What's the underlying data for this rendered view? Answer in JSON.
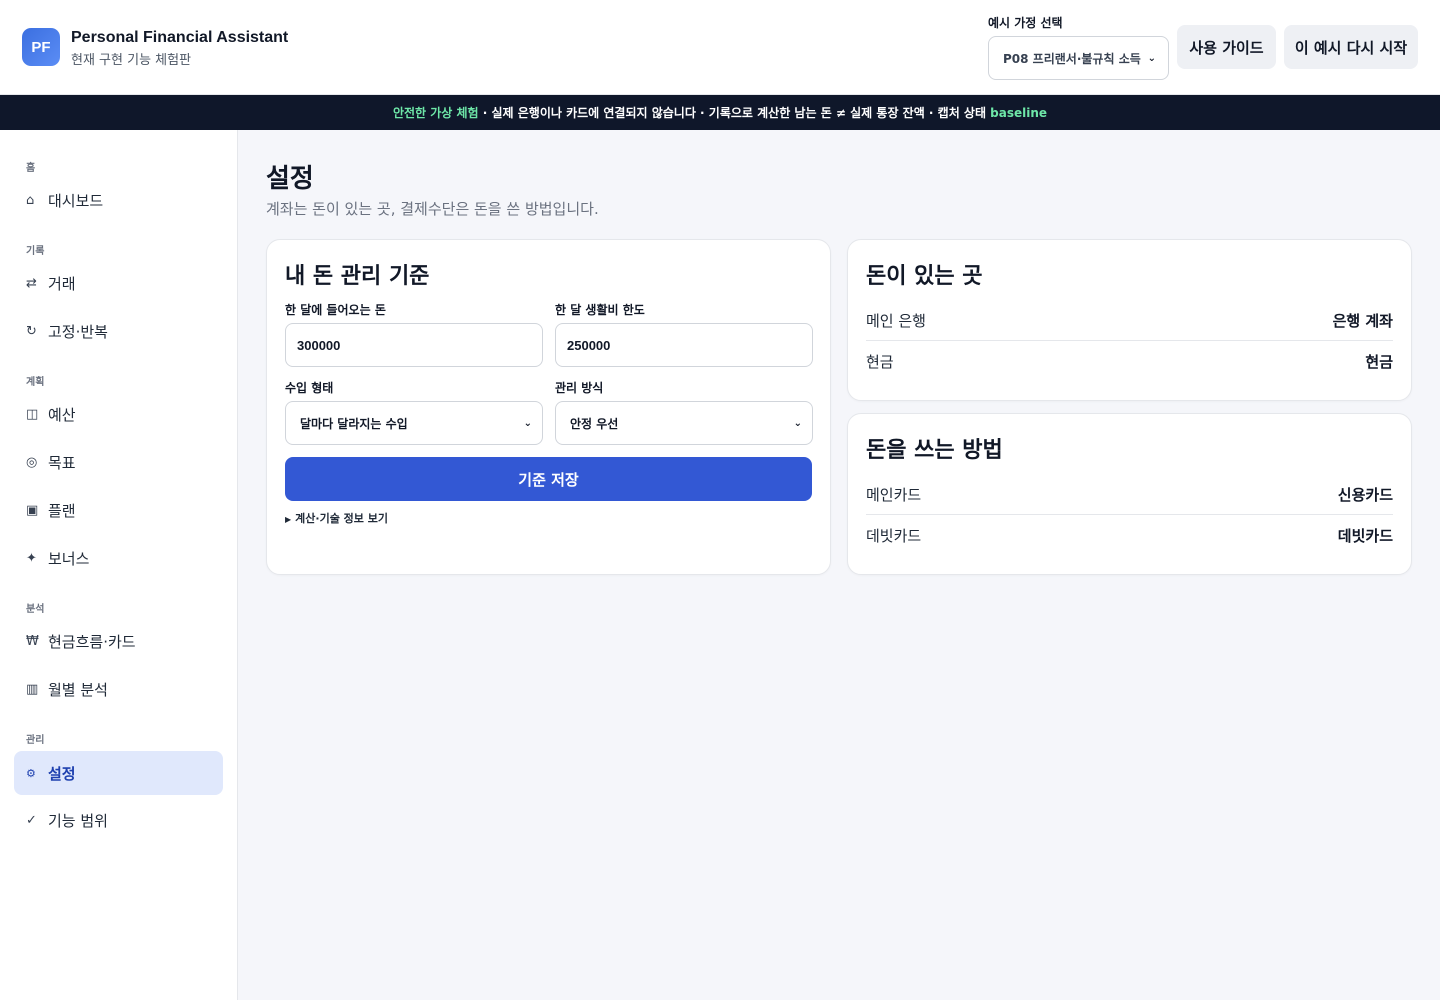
{
  "header": {
    "logo_text": "PF",
    "title": "Personal Financial Assistant",
    "subtitle": "현재 구현 기능 체험판",
    "persona_label": "예시 가정 선택",
    "persona_selected": "P08 프리랜서·불규칙 소득",
    "guide_button": "사용 가이드",
    "restart_button": "이 예시 다시 시작"
  },
  "banner": {
    "highlight": "안전한 가상 체험",
    "text": " · 실제 은행이나 카드에 연결되지 않습니다 · 기록으로 계산한 남는 돈 ≠ 실제 통장 잔액 · 캡처 상태 ",
    "state": "baseline"
  },
  "sidebar": {
    "sections": {
      "home": "홈",
      "records": "기록",
      "plan": "계획",
      "analysis": "분석",
      "manage": "관리"
    },
    "items": [
      {
        "label": "대시보드",
        "icon": "home-icon",
        "glyph": "⌂"
      },
      {
        "label": "거래",
        "icon": "transfer-icon",
        "glyph": "⇄"
      },
      {
        "label": "고정·반복",
        "icon": "repeat-icon",
        "glyph": "↻"
      },
      {
        "label": "예산",
        "icon": "budget-icon",
        "glyph": "◫"
      },
      {
        "label": "목표",
        "icon": "target-icon",
        "glyph": "◎"
      },
      {
        "label": "플랜",
        "icon": "plan-icon",
        "glyph": "▣"
      },
      {
        "label": "보너스",
        "icon": "sparkle-icon",
        "glyph": "✦"
      },
      {
        "label": "현금흐름·카드",
        "icon": "won-icon",
        "glyph": "₩"
      },
      {
        "label": "월별 분석",
        "icon": "bars-icon",
        "glyph": "▥"
      },
      {
        "label": "설정",
        "icon": "gear-icon",
        "glyph": "⚙"
      },
      {
        "label": "기능 범위",
        "icon": "check-icon",
        "glyph": "✓"
      }
    ]
  },
  "main": {
    "title": "설정",
    "subtitle": "계좌는 돈이 있는 곳, 결제수단은 돈을 쓴 방법입니다."
  },
  "standards_card": {
    "title": "내 돈 관리 기준",
    "monthly_income_label": "한 달에 들어오는 돈",
    "monthly_income_value": "300000",
    "living_limit_label": "한 달 생활비 한도",
    "living_limit_value": "250000",
    "income_type_label": "수입 형태",
    "income_type_value": "달마다 달라지는 수입",
    "mode_label": "관리 방식",
    "mode_value": "안정 우선",
    "save_button": "기준 저장",
    "details_toggle": "계산·기술 정보 보기"
  },
  "accounts_card": {
    "title": "돈이 있는 곳",
    "rows": [
      {
        "name": "메인 은행",
        "type": "은행 계좌"
      },
      {
        "name": "현금",
        "type": "현금"
      }
    ]
  },
  "payments_card": {
    "title": "돈을 쓰는 방법",
    "rows": [
      {
        "name": "메인카드",
        "type": "신용카드"
      },
      {
        "name": "데빗카드",
        "type": "데빗카드"
      }
    ]
  },
  "colors": {
    "accent": "#3358d4",
    "banner_bg": "#0f172a",
    "banner_highlight": "#6ee7a8",
    "active_nav_bg": "#e0e8fc"
  }
}
